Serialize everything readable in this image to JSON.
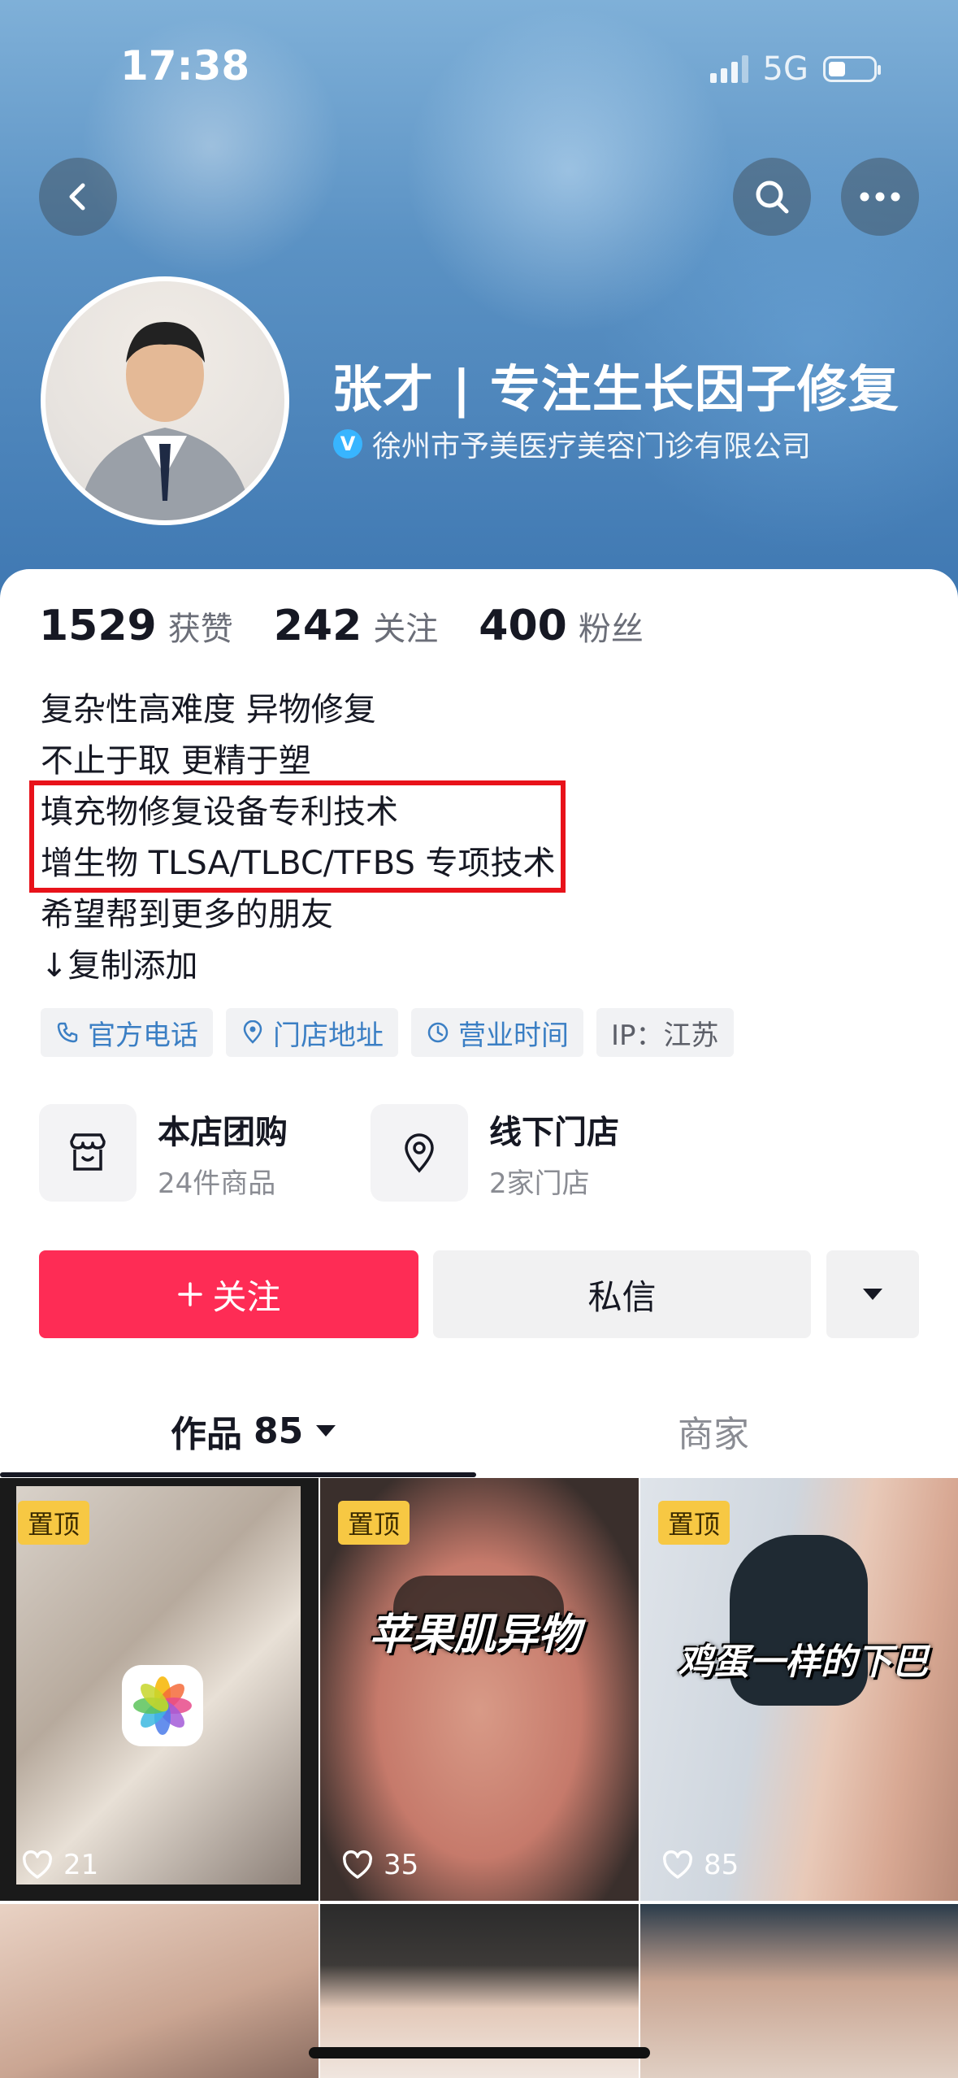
{
  "status_bar": {
    "time": "17:38",
    "network": "5G"
  },
  "profile": {
    "name": "张才 | 专注生长因子修复",
    "verify_badge": "V",
    "company": "徐州市予美医疗美容门诊有限公司",
    "stats": [
      {
        "value": "1529",
        "label": "获赞"
      },
      {
        "value": "242",
        "label": "关注"
      },
      {
        "value": "400",
        "label": "粉丝"
      }
    ],
    "bio_lines": [
      "复杂性高难度 异物修复",
      "不止于取 更精于塑",
      "填充物修复设备专利技术",
      "增生物 TLSA/TLBC/TFBS 专项技术",
      "希望帮到更多的朋友",
      "↓复制添加"
    ],
    "tags": [
      {
        "label": "官方电话",
        "icon": "phone-icon"
      },
      {
        "label": "门店地址",
        "icon": "location-icon"
      },
      {
        "label": "营业时间",
        "icon": "clock-icon"
      },
      {
        "label": "IP：江苏",
        "icon": ""
      }
    ]
  },
  "shop_cards": [
    {
      "title": "本店团购",
      "subtitle": "24件商品",
      "icon": "store-icon"
    },
    {
      "title": "线下门店",
      "subtitle": "2家门店",
      "icon": "map-pin-icon"
    }
  ],
  "actions": {
    "follow": "关注",
    "message": "私信"
  },
  "tabs": {
    "works_label": "作品",
    "works_count": "85",
    "shop_label": "商家"
  },
  "grid": [
    {
      "pinned": "置顶",
      "likes": "21",
      "caption": ""
    },
    {
      "pinned": "置顶",
      "likes": "35",
      "caption": "苹果肌异物"
    },
    {
      "pinned": "置顶",
      "likes": "85",
      "caption": "鸡蛋一样的下巴"
    }
  ],
  "colors": {
    "primary": "#fe2c55",
    "link": "#3b7fc4",
    "highlight": "#e8121a",
    "pin": "#f7c843"
  }
}
